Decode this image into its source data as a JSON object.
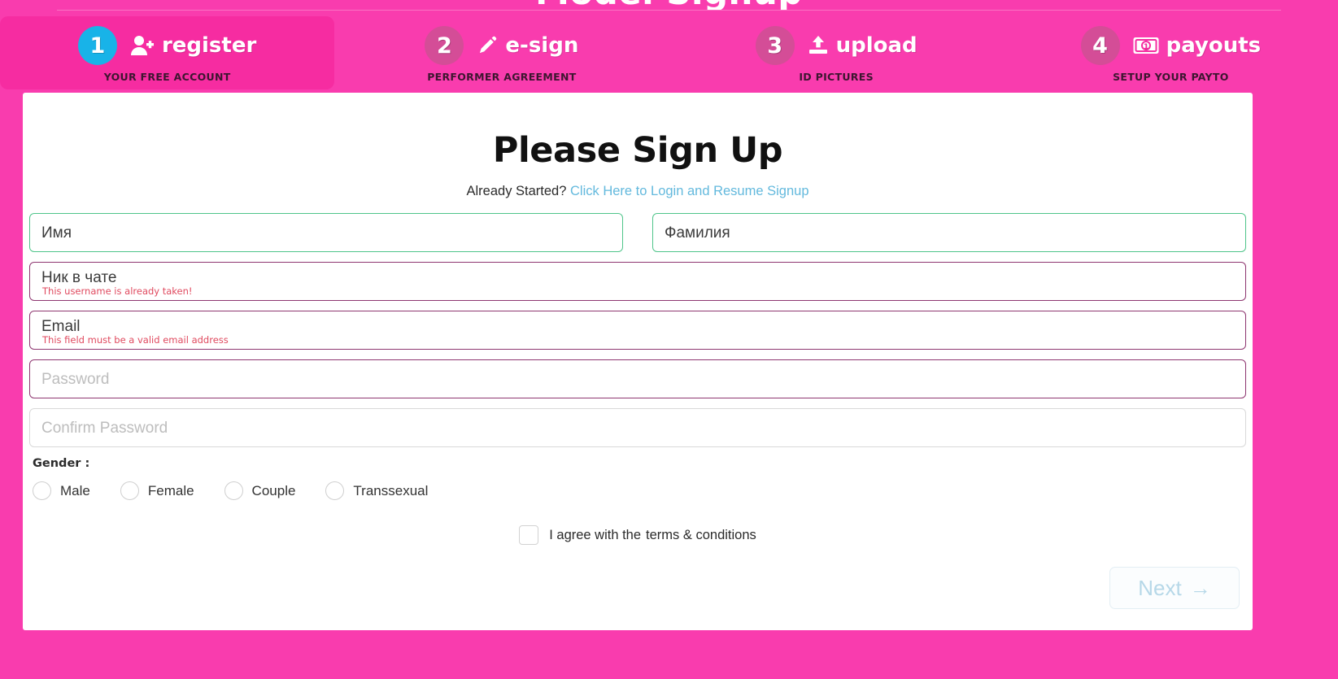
{
  "page": {
    "top_title": "Model Signup",
    "background_color": "#f93cae",
    "accent_active_color": "#f62ca1",
    "step_circle_active_color": "#18b3e8",
    "link_color": "#63b9dd",
    "valid_border_color": "#4fc58a",
    "invalid_border_color": "#8e3670",
    "error_text_color": "#e04a5f"
  },
  "steps": [
    {
      "number": "1",
      "label": "register",
      "sub": "YOUR FREE ACCOUNT",
      "icon": "user-plus-icon",
      "active": true
    },
    {
      "number": "2",
      "label": "e-sign",
      "sub": "PERFORMER AGREEMENT",
      "icon": "pencil-icon",
      "active": false
    },
    {
      "number": "3",
      "label": "upload",
      "sub": "ID PICTURES",
      "icon": "upload-icon",
      "active": false
    },
    {
      "number": "4",
      "label": "payouts",
      "sub": "SETUP YOUR PAYTO",
      "icon": "banknote-icon",
      "active": false
    }
  ],
  "main": {
    "title": "Please Sign Up",
    "already_started_text": "Already Started?",
    "login_link_text": "Click Here to Login and Resume Signup"
  },
  "form": {
    "first_name": {
      "value": "Имя",
      "placeholder": "Имя",
      "state": "valid",
      "error": ""
    },
    "last_name": {
      "value": "Фамилия",
      "placeholder": "Фамилия",
      "state": "valid",
      "error": ""
    },
    "username": {
      "value": "Ник в чате",
      "placeholder": "Ник в чате",
      "state": "invalid",
      "error": "This username is already taken!"
    },
    "email": {
      "value": "Email",
      "placeholder": "Email",
      "state": "invalid",
      "error": "This field must be a valid email address"
    },
    "password": {
      "value": "",
      "placeholder": "Password",
      "state": "invalid",
      "error": ""
    },
    "confirm_password": {
      "value": "",
      "placeholder": "Confirm Password",
      "state": "neutral",
      "error": ""
    },
    "gender": {
      "label": "Gender :",
      "options": [
        {
          "label": "Male",
          "selected": false
        },
        {
          "label": "Female",
          "selected": false
        },
        {
          "label": "Couple",
          "selected": false
        },
        {
          "label": "Transsexual",
          "selected": false
        }
      ]
    },
    "terms": {
      "checked": false,
      "text": "I agree with the",
      "link_text": "terms & conditions"
    },
    "next_button": {
      "label": "Next",
      "arrow": "→",
      "disabled": true
    }
  }
}
